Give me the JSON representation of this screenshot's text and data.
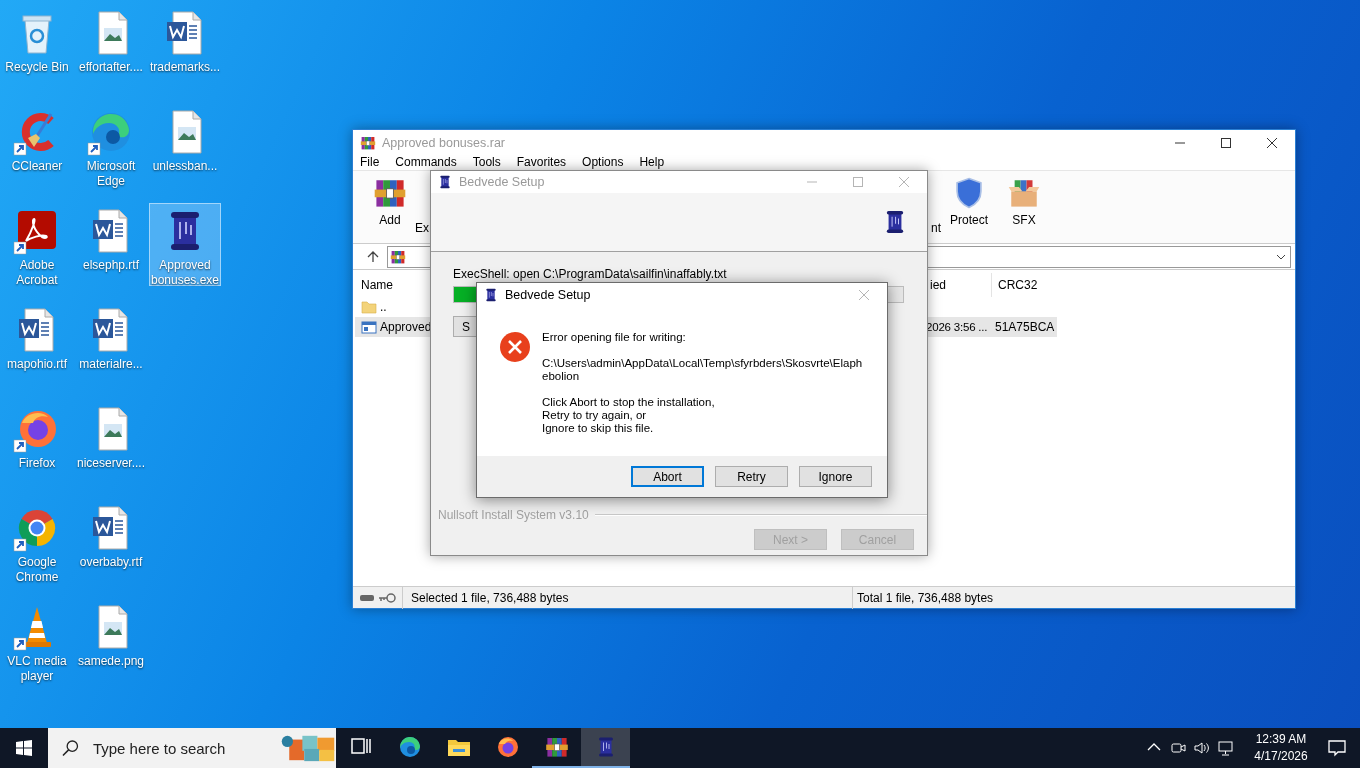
{
  "desktop": {
    "columns": [
      [
        {
          "label": "Recycle Bin",
          "kind": "recycle",
          "shortcut": false,
          "selected": false
        },
        {
          "label": "CCleaner",
          "kind": "broom",
          "shortcut": true,
          "selected": false
        },
        {
          "label": "Adobe Acrobat",
          "kind": "pdf",
          "shortcut": true,
          "selected": false
        },
        {
          "label": "mapohio.rtf",
          "kind": "word",
          "shortcut": false,
          "selected": false
        },
        {
          "label": "Firefox",
          "kind": "firefox",
          "shortcut": true,
          "selected": false
        },
        {
          "label": "Google Chrome",
          "kind": "chrome",
          "shortcut": true,
          "selected": false
        },
        {
          "label": "VLC media player",
          "kind": "cone",
          "shortcut": true,
          "selected": false
        }
      ],
      [
        {
          "label": "effortafter....",
          "kind": "image",
          "shortcut": false,
          "selected": false
        },
        {
          "label": "Microsoft Edge",
          "kind": "edge",
          "shortcut": true,
          "selected": false
        },
        {
          "label": "elsephp.rtf",
          "kind": "word",
          "shortcut": false,
          "selected": false
        },
        {
          "label": "materialre...",
          "kind": "word",
          "shortcut": false,
          "selected": false
        },
        {
          "label": "niceserver....",
          "kind": "image",
          "shortcut": false,
          "selected": false
        },
        {
          "label": "overbaby.rtf",
          "kind": "word",
          "shortcut": false,
          "selected": false
        },
        {
          "label": "samede.png",
          "kind": "image",
          "shortcut": false,
          "selected": false
        }
      ],
      [
        {
          "label": "trademarks...",
          "kind": "word",
          "shortcut": false,
          "selected": false
        },
        {
          "label": "unlessban...",
          "kind": "image",
          "shortcut": false,
          "selected": false
        },
        {
          "label": "Approved bonuses.exe",
          "kind": "scroll",
          "shortcut": false,
          "selected": true
        }
      ]
    ]
  },
  "archive_window": {
    "title": "Approved bonuses.rar",
    "active": false,
    "menu": [
      "File",
      "Commands",
      "Tools",
      "Favorites",
      "Options",
      "Help"
    ],
    "toolbar": [
      {
        "label": "Add",
        "kind": "add"
      },
      {
        "label": "Ex",
        "kind": "text"
      },
      {
        "label": "nt",
        "kind": "text"
      },
      {
        "label": "Protect",
        "kind": "protect"
      },
      {
        "label": "SFX",
        "kind": "sfx"
      }
    ],
    "columns": [
      "Name",
      "ied",
      "CRC32"
    ],
    "rows": [
      {
        "kind": "folder",
        "name": "..",
        "selected": false
      },
      {
        "kind": "exe",
        "name": "Approved",
        "modified": "2026 3:56 ...",
        "crc32": "51A75BCA",
        "selected": true
      }
    ],
    "status_left": "Selected 1 file, 736,488 bytes",
    "status_right": "Total 1 file, 736,488 bytes"
  },
  "setup_window": {
    "title": "Bedvede Setup",
    "active": false,
    "status": "ExecShell: open C:\\ProgramData\\sailfin\\inaffably.txt",
    "progress": {
      "level": 0.05
    },
    "details_button": "S",
    "brand": "Nullsoft Install System v3.10",
    "buttons": [
      {
        "label": "Next >",
        "disabled": true
      },
      {
        "label": "Cancel",
        "disabled": true
      }
    ]
  },
  "error_dialog": {
    "title": "Bedvede Setup",
    "active": true,
    "paragraphs": [
      "Error opening file for writing:",
      "C:\\Users\\admin\\AppData\\Local\\Temp\\sfyrbders\\Skosvrte\\Elaph\nebolion",
      "Click Abort to stop the installation,\nRetry to try again, or\nIgnore to skip this file."
    ],
    "buttons": [
      {
        "label": "Abort",
        "focused": true
      },
      {
        "label": "Retry",
        "focused": false
      },
      {
        "label": "Ignore",
        "focused": false
      }
    ]
  },
  "taskbar": {
    "search": {
      "placeholder": "Type here to search"
    },
    "apps": [
      {
        "kind": "taskview",
        "running": false,
        "active": false
      },
      {
        "kind": "edge",
        "running": false,
        "active": false
      },
      {
        "kind": "folder",
        "running": false,
        "active": false
      },
      {
        "kind": "firefox",
        "running": false,
        "active": false
      },
      {
        "kind": "books",
        "running": true,
        "active": false
      },
      {
        "kind": "scroll",
        "running": true,
        "active": true
      }
    ],
    "clock": {
      "time": "12:39 AM",
      "date": "4/17/2026"
    }
  }
}
